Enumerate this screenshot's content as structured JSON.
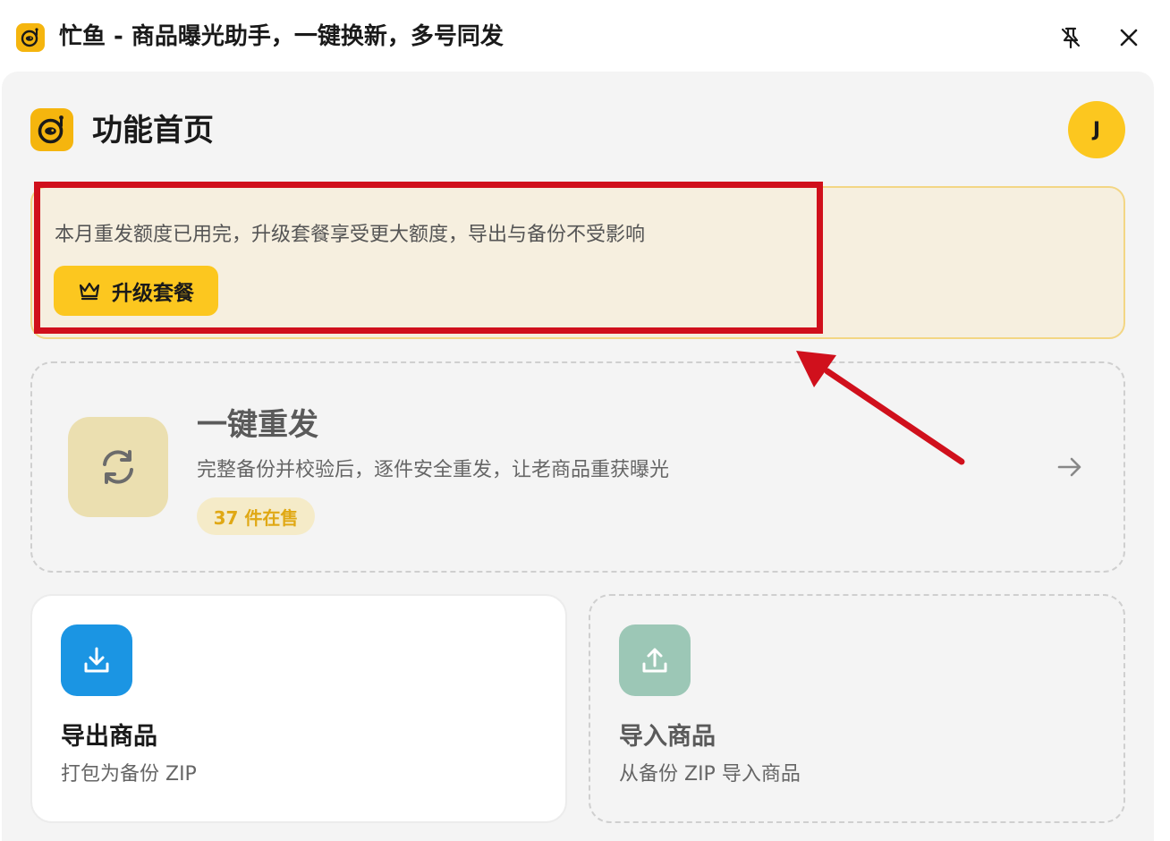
{
  "window": {
    "title": "忙鱼 - 商品曝光助手，一键换新，多号同发",
    "logo_icon": "fish-logo-icon",
    "pin_icon": "unpin-icon",
    "close_icon": "close-icon"
  },
  "header": {
    "title": "功能首页",
    "avatar_initial": "J"
  },
  "banner": {
    "message": "本月重发额度已用完，升级套餐享受更大额度，导出与备份不受影响",
    "upgrade_label": "升级套餐",
    "upgrade_icon": "crown-icon"
  },
  "repost": {
    "title": "一键重发",
    "description": "完整备份并校验后，逐件安全重发，让老商品重获曝光",
    "badge": "37 件在售",
    "icon": "refresh-icon",
    "arrow_icon": "arrow-right-icon"
  },
  "export": {
    "title": "导出商品",
    "description": "打包为备份 ZIP",
    "icon": "download-icon"
  },
  "import": {
    "title": "导入商品",
    "description": "从备份 ZIP 导入商品",
    "icon": "upload-icon"
  },
  "colors": {
    "brand_yellow": "#fcc71f",
    "banner_bg": "#f6efdf",
    "annotation_red": "#d0101c",
    "export_blue": "#1b95e3",
    "import_green": "#9cc7b6"
  }
}
